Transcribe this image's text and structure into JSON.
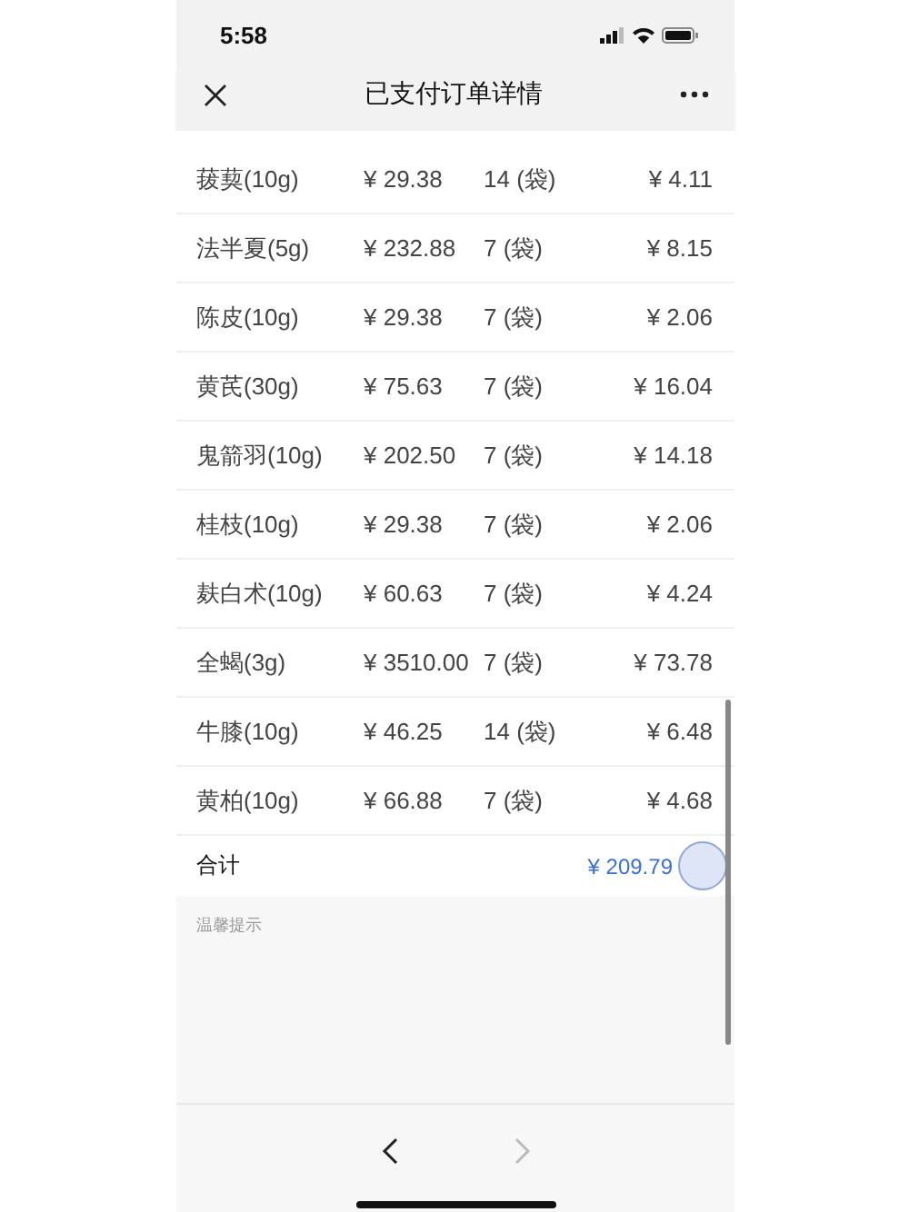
{
  "status_bar": {
    "time": "5:58"
  },
  "nav_bar": {
    "title": "已支付订单详情"
  },
  "rows": [
    {
      "name": "菝葜(10g)",
      "price": "¥ 29.38",
      "qty": "14 (袋)",
      "amount": "¥ 4.11"
    },
    {
      "name": "法半夏(5g)",
      "price": "¥ 232.88",
      "qty": "7 (袋)",
      "amount": "¥ 8.15"
    },
    {
      "name": "陈皮(10g)",
      "price": "¥ 29.38",
      "qty": "7 (袋)",
      "amount": "¥ 2.06"
    },
    {
      "name": "黄芪(30g)",
      "price": "¥ 75.63",
      "qty": "7 (袋)",
      "amount": "¥ 16.04"
    },
    {
      "name": "鬼箭羽(10g)",
      "price": "¥ 202.50",
      "qty": "7 (袋)",
      "amount": "¥ 14.18"
    },
    {
      "name": "桂枝(10g)",
      "price": "¥ 29.38",
      "qty": "7 (袋)",
      "amount": "¥ 2.06"
    },
    {
      "name": "麸白术(10g)",
      "price": "¥ 60.63",
      "qty": "7 (袋)",
      "amount": "¥ 4.24"
    },
    {
      "name": "全蝎(3g)",
      "price": "¥ 3510.00",
      "qty": "7 (袋)",
      "amount": "¥ 73.78"
    },
    {
      "name": "牛膝(10g)",
      "price": "¥ 46.25",
      "qty": "14 (袋)",
      "amount": "¥ 6.48"
    },
    {
      "name": "黄柏(10g)",
      "price": "¥ 66.88",
      "qty": "7 (袋)",
      "amount": "¥ 4.68"
    }
  ],
  "total": {
    "label": "合计",
    "value": "¥ 209.79"
  },
  "tips": {
    "title": "温馨提示"
  }
}
